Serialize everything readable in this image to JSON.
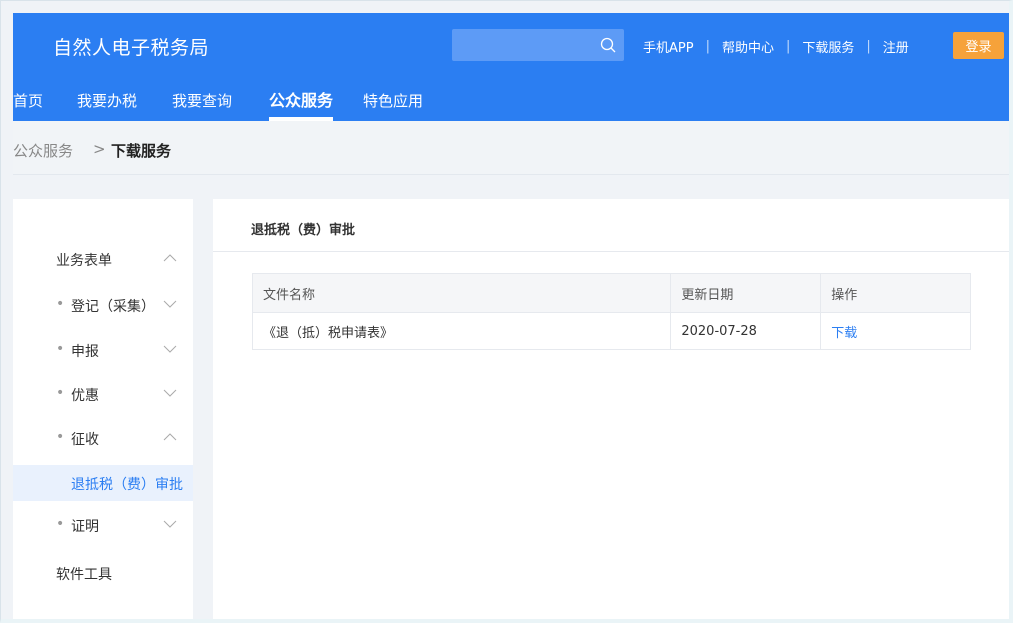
{
  "header": {
    "logo": "自然人电子税务局",
    "search": {
      "placeholder": "",
      "value": ""
    },
    "links": [
      "手机APP",
      "帮助中心",
      "下载服务",
      "注册"
    ],
    "login_label": "登录"
  },
  "nav": {
    "items": [
      "首页",
      "我要办税",
      "我要查询",
      "公众服务",
      "特色应用"
    ],
    "active": "公众服务"
  },
  "breadcrumb": {
    "parent": "公众服务",
    "separator": ">",
    "current": "下载服务"
  },
  "sidebar": {
    "group_title": "业务表单",
    "items": [
      {
        "label": "登记（采集）",
        "bullet": "•"
      },
      {
        "label": "申报",
        "bullet": "•"
      },
      {
        "label": "优惠",
        "bullet": "•"
      },
      {
        "label": "征收",
        "bullet": "•"
      },
      {
        "label": "退抵税（费）审批"
      },
      {
        "label": "证明",
        "bullet": "•"
      }
    ],
    "tools_label": "软件工具"
  },
  "content": {
    "title": "退抵税（费）审批",
    "table": {
      "headers": [
        "文件名称",
        "更新日期",
        "操作"
      ],
      "rows": [
        {
          "name": "《退（抵）税申请表》",
          "date": "2020-07-28",
          "action": "下载"
        }
      ]
    }
  },
  "colors": {
    "header_blue": "#2b7ef2",
    "login_orange": "#f6a23a",
    "link_blue": "#2b7ef2",
    "active_bg": "#e9f1fd"
  }
}
